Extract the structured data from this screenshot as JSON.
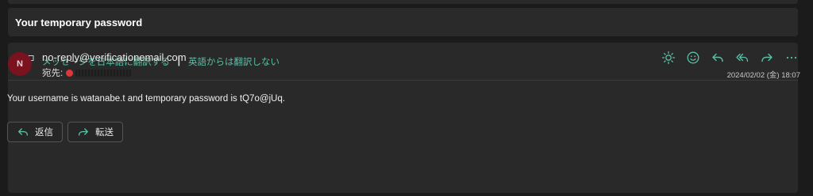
{
  "subject": {
    "title": "Your temporary password"
  },
  "translation_bar": {
    "translate_link": "メッセージを日本語に翻訳する",
    "separator": "|",
    "never_translate_link": "英語からは翻訳しない"
  },
  "message": {
    "avatar_initial": "N",
    "sender": "no-reply@verificationemail.com",
    "to_label": "宛先:",
    "datetime": "2024/02/02 (金) 18:07",
    "body": "Your username is watanabe.t and temporary password is tQ7o@jUq."
  },
  "actions": {
    "icons": [
      "sun-icon",
      "emoji-icon",
      "reply-icon",
      "reply-all-icon",
      "forward-icon",
      "more-icon"
    ]
  },
  "buttons": {
    "reply_label": "返信",
    "forward_label": "転送"
  },
  "colors": {
    "background": "#1b1b1b",
    "card": "#292929",
    "link": "#59c0a6",
    "avatar": "#7a1220",
    "recipient_dot": "#e0353c"
  }
}
